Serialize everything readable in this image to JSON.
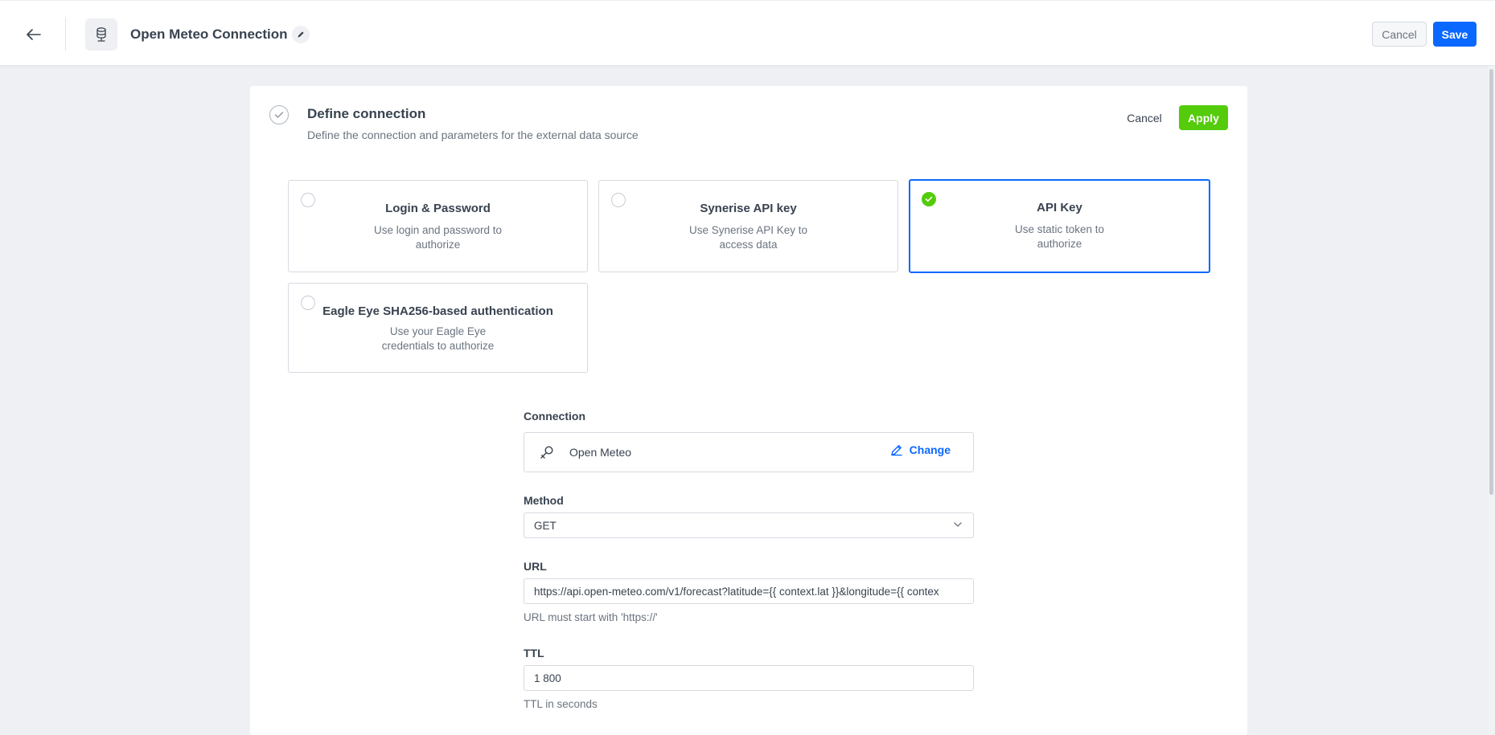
{
  "header": {
    "title": "Open Meteo Connection",
    "cancel_label": "Cancel",
    "save_label": "Save"
  },
  "step": {
    "title": "Define connection",
    "description": "Define the connection and parameters for the external data source",
    "cancel_label": "Cancel",
    "apply_label": "Apply"
  },
  "auth_options": [
    {
      "title": "Login & Password",
      "description": "Use login and password to authorize",
      "selected": false
    },
    {
      "title": "Synerise API key",
      "description": "Use Synerise API Key to access data",
      "selected": false
    },
    {
      "title": "API Key",
      "description": "Use static token to authorize",
      "selected": true
    },
    {
      "title": "Eagle Eye SHA256-based authentication",
      "description": "Use your Eagle Eye credentials to authorize",
      "selected": false
    }
  ],
  "form": {
    "connection": {
      "label": "Connection",
      "value": "Open Meteo",
      "change_label": "Change"
    },
    "method": {
      "label": "Method",
      "value": "GET"
    },
    "url": {
      "label": "URL",
      "value": "https://api.open-meteo.com/v1/forecast?latitude={{ context.lat }}&longitude={{ contex",
      "hint": "URL must start with 'https://'"
    },
    "ttl": {
      "label": "TTL",
      "value": "1 800",
      "hint": "TTL in seconds"
    }
  },
  "colors": {
    "primary": "#0b68ff",
    "success": "#54cb0b"
  },
  "icons": [
    "arrow-left-icon",
    "database-icon",
    "pencil-icon",
    "check-circle-icon",
    "key-icon",
    "chevron-down-icon"
  ]
}
